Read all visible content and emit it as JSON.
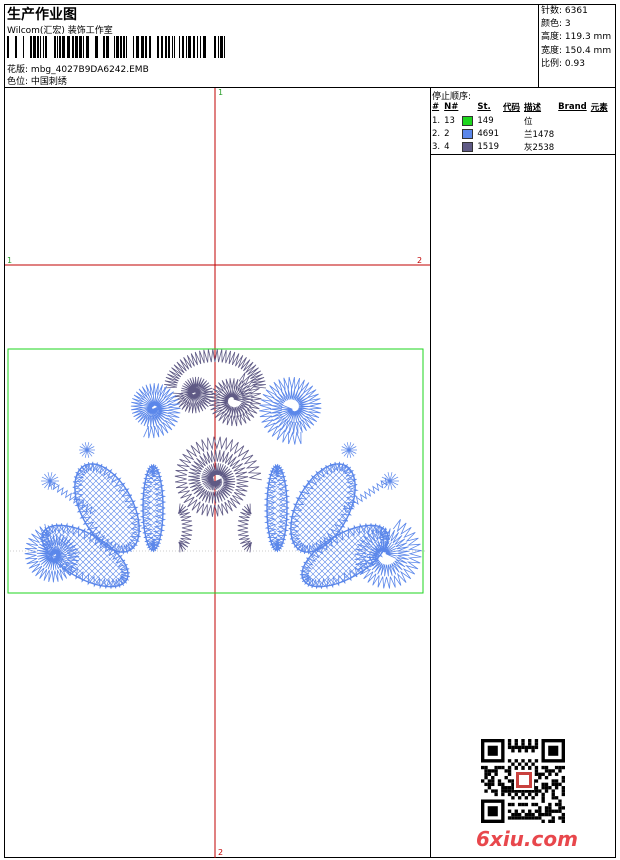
{
  "header": {
    "title": "生产作业图",
    "company": "Wilcom(汇宏) 装饰工作室",
    "design_label": "花版:",
    "design_file": "mbg_4027B9DA6242.EMB",
    "colorway_label": "色位:",
    "colorway": "中国刺绣"
  },
  "stats": [
    {
      "label": "针数:",
      "value": "6361"
    },
    {
      "label": "颜色:",
      "value": "3"
    },
    {
      "label": "高度:",
      "value": "119.3 mm"
    },
    {
      "label": "宽度:",
      "value": "150.4 mm"
    },
    {
      "label": "比例:",
      "value": "0.93"
    }
  ],
  "stop_sequence": {
    "title": "停止顺序:",
    "headers": [
      "#",
      "N#",
      "St.",
      "代码",
      "描述",
      "Brand",
      "元素"
    ],
    "rows": [
      {
        "num": "1.",
        "n": "13",
        "color": "#1ed61e",
        "st": "149",
        "code": "",
        "desc": "位"
      },
      {
        "num": "2.",
        "n": "2",
        "color": "#5b87ea",
        "st": "4691",
        "code": "",
        "desc": "兰1478"
      },
      {
        "num": "3.",
        "n": "4",
        "color": "#5f5a85",
        "st": "1519",
        "code": "",
        "desc": "灰2538"
      }
    ]
  },
  "guides": {
    "top_label": "1",
    "bottom_label": "2",
    "left_label": "1",
    "right_label": "2"
  },
  "colors": {
    "outline": "#1ed61e",
    "blue": "#5b87ea",
    "grey": "#5f5a85",
    "guide": "#c00000"
  },
  "watermark": "6xiu.com"
}
